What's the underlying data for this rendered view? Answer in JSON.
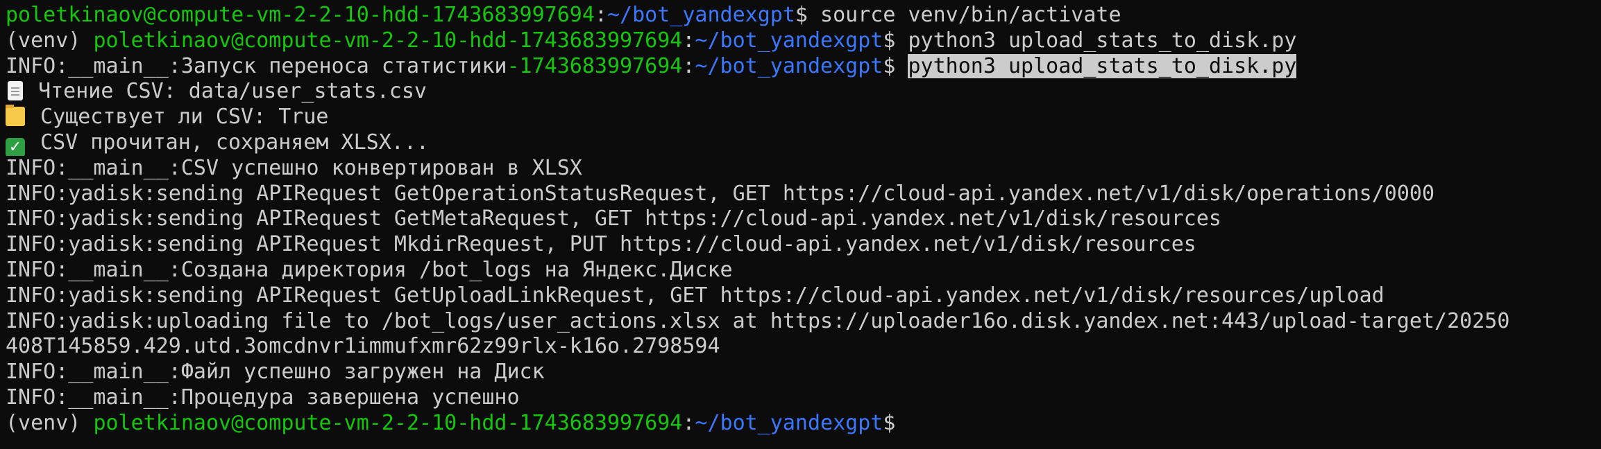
{
  "colors": {
    "background": "#0c0c0c",
    "text": "#cccccc",
    "prompt_user": "#16c60c",
    "prompt_path": "#3b78ff",
    "selection_bg": "#cccccc"
  },
  "prompt": {
    "venv": "(venv) ",
    "user_host": "poletkinaov@compute-vm-2-2-10-hdd-1743683997694",
    "colon": ":",
    "path": "~/bot_yandexgpt",
    "dollar": "$ "
  },
  "lines": {
    "l1_cmd": "source venv/bin/activate",
    "l2_cmd": "python3 upload_stats_to_disk.py",
    "l3_info": "INFO:__main__:Запуск переноса статистики",
    "l3_green": "-1743683997694",
    "l3_selected": "python3 upload_stats_to_disk.py",
    "l4_icon": "page-icon",
    "l4_text": "Чтение CSV: data/user_stats.csv",
    "l5_icon": "folder-icon",
    "l5_text": "Существует ли CSV: True",
    "l6_icon": "check-mark-icon",
    "l6_glyph": "✓",
    "l6_text": "CSV прочитан, сохраняем XLSX...",
    "l7": "INFO:__main__:CSV успешно конвертирован в XLSX",
    "l8": "INFO:yadisk:sending APIRequest GetOperationStatusRequest, GET https://cloud-api.yandex.net/v1/disk/operations/0000",
    "l9": "INFO:yadisk:sending APIRequest GetMetaRequest, GET https://cloud-api.yandex.net/v1/disk/resources",
    "l10": "INFO:yadisk:sending APIRequest MkdirRequest, PUT https://cloud-api.yandex.net/v1/disk/resources",
    "l11": "INFO:__main__:Создана директория /bot_logs на Яндекс.Диске",
    "l12": "INFO:yadisk:sending APIRequest GetUploadLinkRequest, GET https://cloud-api.yandex.net/v1/disk/resources/upload",
    "l13": "INFO:yadisk:uploading file to /bot_logs/user_actions.xlsx at https://uploader16o.disk.yandex.net:443/upload-target/20250",
    "l14": "408T145859.429.utd.3omcdnvr1immufxmr62z99rlx-k16o.2798594",
    "l15": "INFO:__main__:Файл успешно загружен на Диск",
    "l16": "INFO:__main__:Процедура завершена успешно"
  }
}
